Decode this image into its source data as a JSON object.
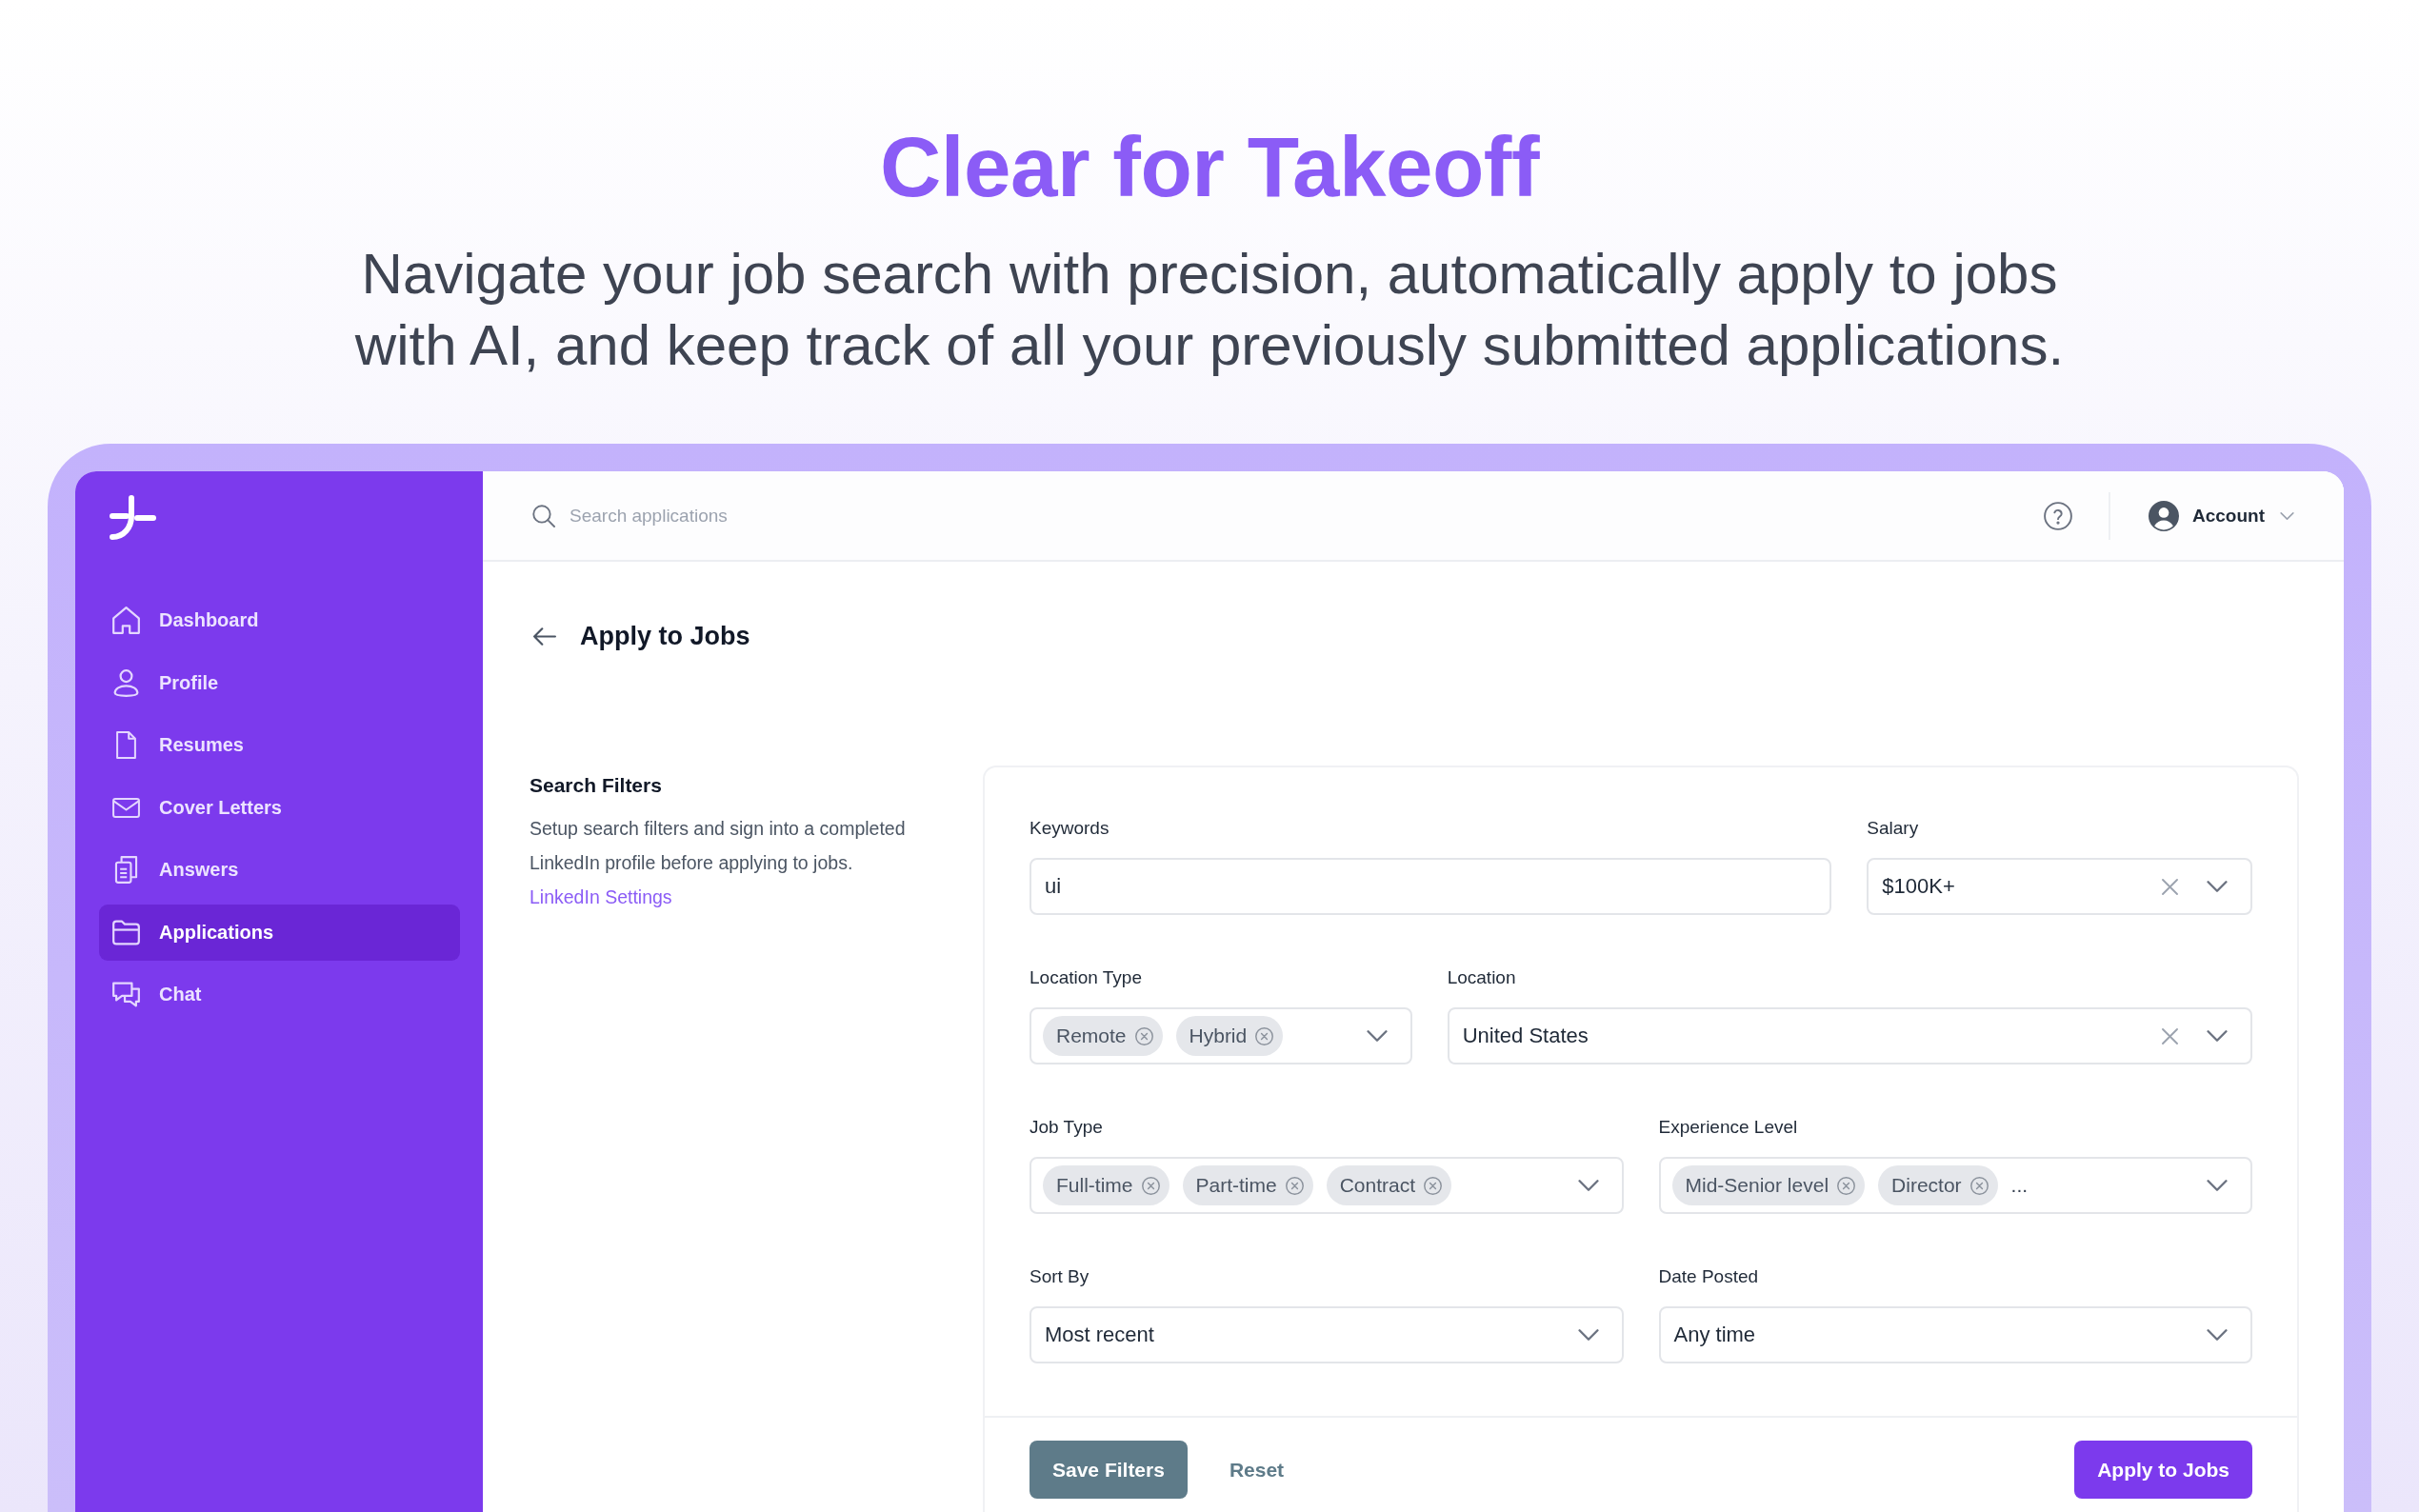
{
  "hero": {
    "title": "Clear for Takeoff",
    "subtitle": "Navigate your job search with precision, automatically apply to jobs with AI, and keep track of all your previously submitted applications."
  },
  "sidebar": {
    "items": [
      {
        "label": "Dashboard",
        "selected": false
      },
      {
        "label": "Profile",
        "selected": false
      },
      {
        "label": "Resumes",
        "selected": false
      },
      {
        "label": "Cover Letters",
        "selected": false
      },
      {
        "label": "Answers",
        "selected": false
      },
      {
        "label": "Applications",
        "selected": true
      },
      {
        "label": "Chat",
        "selected": false
      }
    ]
  },
  "top_bar": {
    "search": {
      "placeholder": "Search applications"
    },
    "account": {
      "label": "Account"
    }
  },
  "page": {
    "title": "Apply to Jobs"
  },
  "search_filters": {
    "title": "Search Filters",
    "description": "Setup search filters and sign into a completed LinkedIn profile before applying to jobs.",
    "link": "LinkedIn Settings"
  },
  "form": {
    "rows": [
      [
        {
          "label": "Keywords",
          "kind": "text",
          "value": "ui"
        },
        {
          "label": "Salary",
          "kind": "select",
          "value": "$100K+",
          "clearable": true
        }
      ],
      [
        {
          "label": "Location Type",
          "kind": "multiselect",
          "tags": [
            "Remote",
            "Hybrid"
          ]
        },
        {
          "label": "Location",
          "kind": "select",
          "value": "United States",
          "clearable": true
        }
      ],
      [
        {
          "label": "Job Type",
          "kind": "multiselect",
          "tags": [
            "Full-time",
            "Part-time",
            "Contract"
          ]
        },
        {
          "label": "Experience Level",
          "kind": "multiselect",
          "tags": [
            "Mid-Senior level",
            "Director"
          ],
          "overflow": "..."
        }
      ],
      [
        {
          "label": "Sort By",
          "kind": "select",
          "value": "Most recent",
          "clearable": false
        },
        {
          "label": "Date Posted",
          "kind": "select",
          "value": "Any time",
          "clearable": false
        }
      ]
    ],
    "buttons": [
      {
        "label": "Save Filters",
        "kind": "secondary"
      },
      {
        "label": "Reset",
        "kind": "text"
      },
      {
        "label": "Apply to Jobs",
        "kind": "primary"
      }
    ]
  }
}
